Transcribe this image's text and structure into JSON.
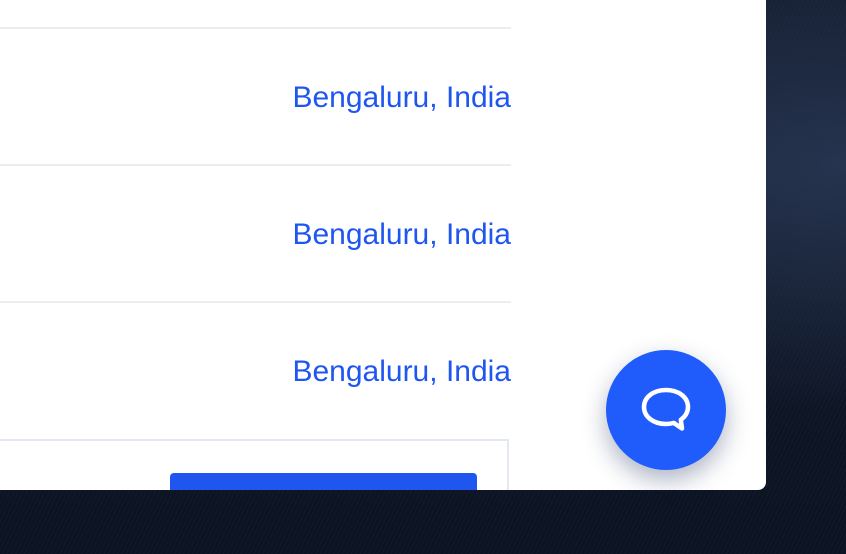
{
  "listings": [
    {
      "city": "Bengaluru",
      "separator": ",",
      "country": "India"
    },
    {
      "city": "Bengaluru",
      "separator": ",",
      "country": "India"
    },
    {
      "city": "Bengaluru",
      "separator": ",",
      "country": "India"
    }
  ],
  "chat_launcher": {
    "icon": "chat-bubble-icon"
  },
  "colors": {
    "accent": "#1f56f0",
    "launcher": "#1f5cfb",
    "divider": "#ebedf1",
    "backdrop": "#0f172a"
  }
}
